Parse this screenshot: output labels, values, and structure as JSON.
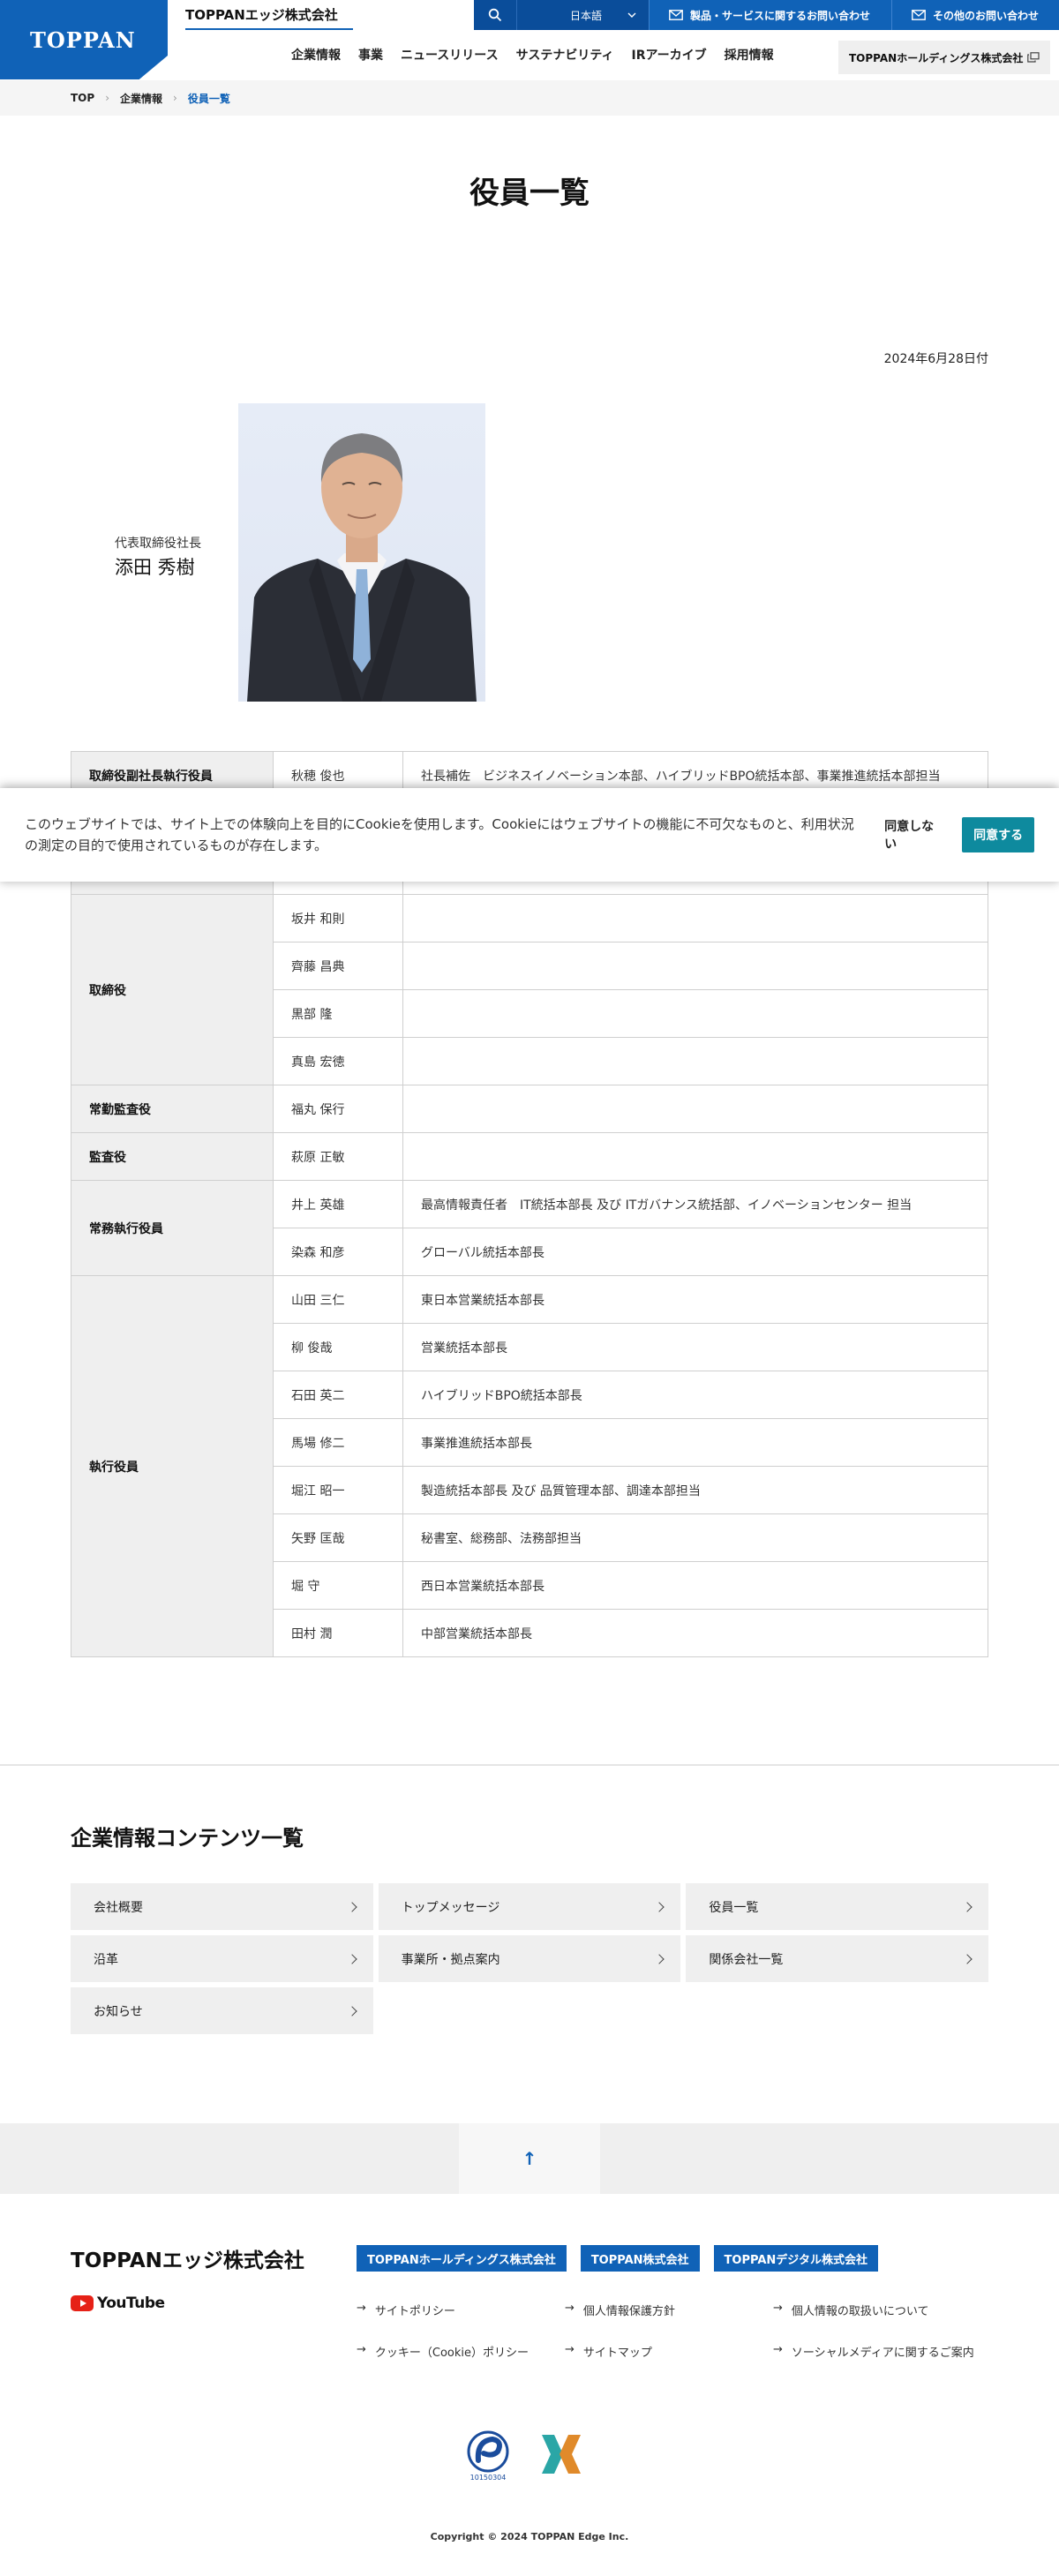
{
  "header": {
    "logo": "TOPPAN",
    "company_name": "TOPPANエッジ株式会社",
    "language": "日本語",
    "contact_products": "製品・サービスに関するお問い合わせ",
    "contact_other": "その他のお問い合わせ",
    "holdings_link": "TOPPANホールディングス株式会社",
    "nav": [
      "企業情報",
      "事業",
      "ニュースリリース",
      "サステナビリティ",
      "IRアーカイブ",
      "採用情報"
    ]
  },
  "breadcrumb": {
    "items": [
      "TOP",
      "企業情報"
    ],
    "current": "役員一覧"
  },
  "page": {
    "title": "役員一覧",
    "date": "2024年6月28日付"
  },
  "president": {
    "title": "代表取締役社長",
    "name": "添田 秀樹"
  },
  "officers": {
    "row0": {
      "role": "取締役副社長執行役員",
      "name": "秋穂 俊也",
      "duty": "社長補佐　ビジネスイノベーション本部、ハイブリッドBPO統括本部、事業推進統括本部担当"
    },
    "row1": {
      "role": "",
      "name": "",
      "duty": ""
    },
    "row2": {
      "role": "",
      "name": "",
      "duty": ""
    },
    "directors_role": "取締役",
    "directors": [
      "坂井 和則",
      "齊藤 昌典",
      "黒部 隆",
      "真島 宏徳"
    ],
    "auditor_fulltime": {
      "role": "常勤監査役",
      "name": "福丸 保行",
      "duty": ""
    },
    "auditor": {
      "role": "監査役",
      "name": "萩原 正敏",
      "duty": ""
    },
    "managing_role": "常務執行役員",
    "managing": [
      {
        "name": "井上 英雄",
        "duty": "最高情報責任者　IT統括本部長 及び ITガバナンス統括部、イノベーションセンター 担当"
      },
      {
        "name": "染森 和彦",
        "duty": "グローバル統括本部長"
      }
    ],
    "executive_role": "執行役員",
    "executives": [
      {
        "name": "山田 三仁",
        "duty": "東日本営業統括本部長"
      },
      {
        "name": "柳 俊哉",
        "duty": "営業統括本部長"
      },
      {
        "name": "石田 英二",
        "duty": "ハイブリッドBPO統括本部長"
      },
      {
        "name": "馬場 修二",
        "duty": "事業推進統括本部長"
      },
      {
        "name": "堀江 昭一",
        "duty": "製造統括本部長 及び 品質管理本部、調達本部担当"
      },
      {
        "name": "矢野 匡哉",
        "duty": "秘書室、総務部、法務部担当"
      },
      {
        "name": "堀 守",
        "duty": "西日本営業統括本部長"
      },
      {
        "name": "田村 潤",
        "duty": "中部営業統括本部長"
      }
    ]
  },
  "cookie": {
    "text": "このウェブサイトでは、サイト上での体験向上を目的にCookieを使用します。Cookieにはウェブサイトの機能に不可欠なものと、利用状況の測定の目的で使用されているものが存在します。",
    "decline": "同意しない",
    "accept": "同意する"
  },
  "contents": {
    "title": "企業情報コンテンツ一覧",
    "items": [
      "会社概要",
      "トップメッセージ",
      "役員一覧",
      "沿革",
      "事業所・拠点案内",
      "関係会社一覧",
      "お知らせ"
    ]
  },
  "totop": "↑",
  "footer": {
    "company": "TOPPANエッジ株式会社",
    "youtube": "YouTube",
    "group_links": [
      "TOPPANホールディングス株式会社",
      "TOPPAN株式会社",
      "TOPPANデジタル株式会社"
    ],
    "links": [
      "サイトポリシー",
      "個人情報保護方針",
      "個人情報の取扱いについて",
      "クッキー（Cookie）ポリシー",
      "サイトマップ",
      "ソーシャルメディアに関するご案内"
    ],
    "privacy_mark_number": "10150304",
    "copyright": "Copyright © 2024 TOPPAN Edge Inc."
  }
}
